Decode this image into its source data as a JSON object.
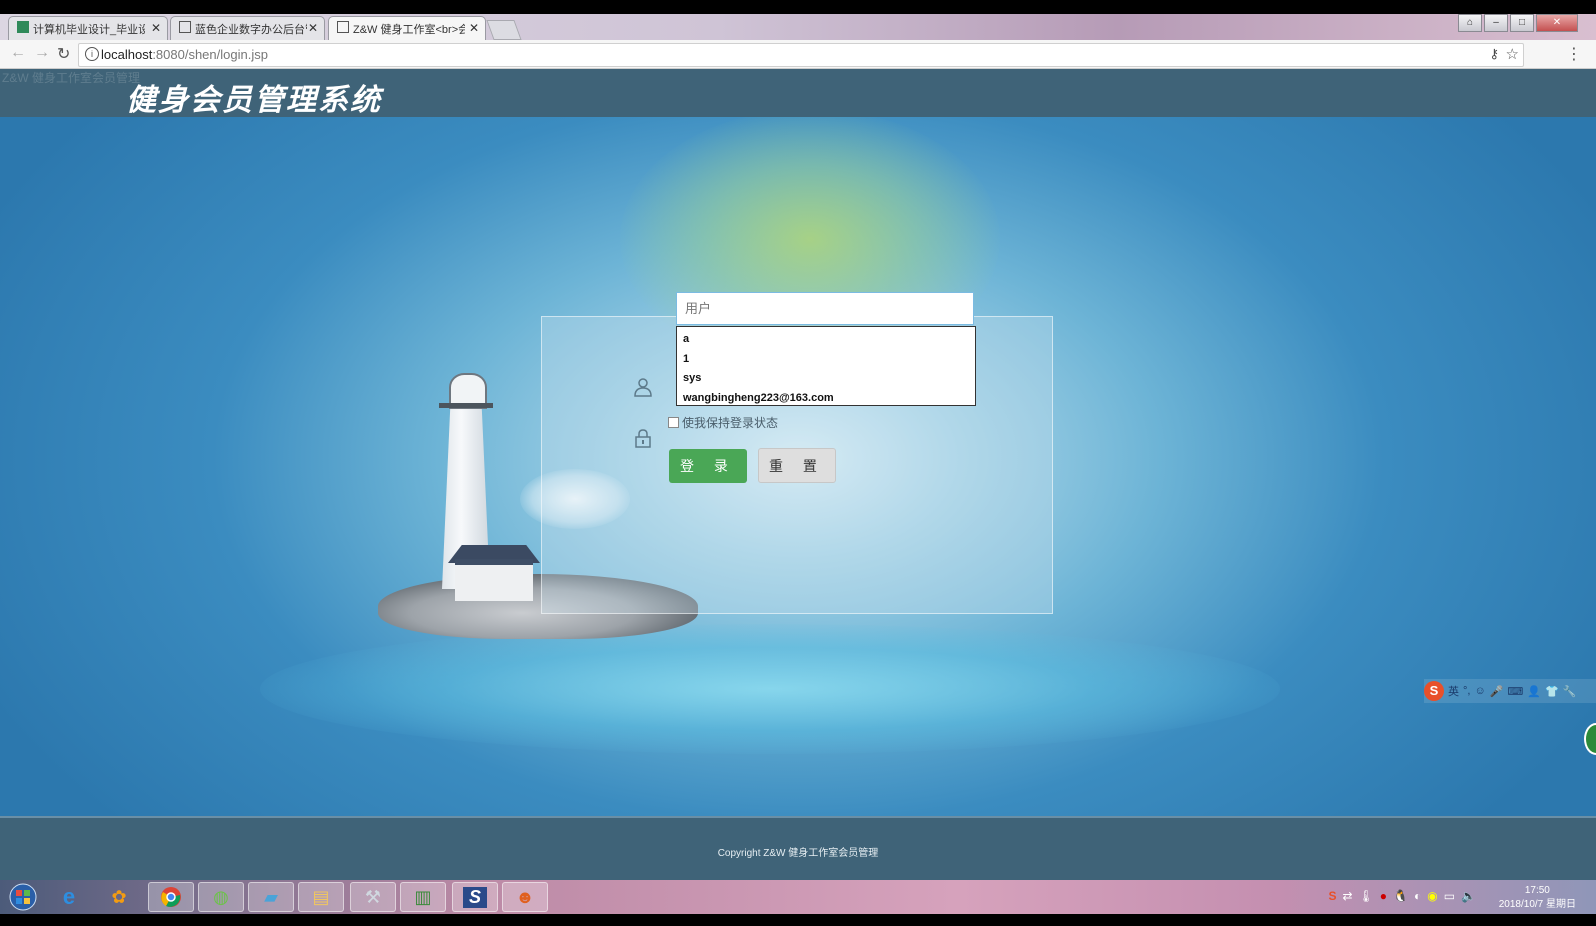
{
  "browser": {
    "tabs": [
      {
        "title": "计算机毕业设计_毕业设",
        "active": false
      },
      {
        "title": "蓝色企业数字办公后台管",
        "active": false
      },
      {
        "title": "Z&W 健身工作室<br>会",
        "active": true
      }
    ],
    "url_host": "localhost",
    "url_rest": ":8080/shen/login.jsp"
  },
  "header": {
    "small_title": "Z&W 健身工作室会员管理",
    "logo": "健身会员管理系统"
  },
  "login": {
    "username_placeholder": "用户",
    "remember_label": "使我保持登录状态",
    "login_button": "登 录",
    "reset_button": "重 置"
  },
  "autocomplete": [
    "a",
    "1",
    "sys",
    "wangbingheng223@163.com"
  ],
  "footer": {
    "copyright": "Copyright Z&W 健身工作室会员管理"
  },
  "ime": {
    "mode": "英"
  },
  "taskbar": {
    "time": "17:50",
    "date": "2018/10/7 星期日"
  },
  "colors": {
    "header_bg": "#3f6378",
    "login_green": "#4aa756",
    "reset_gray": "#dedede"
  }
}
